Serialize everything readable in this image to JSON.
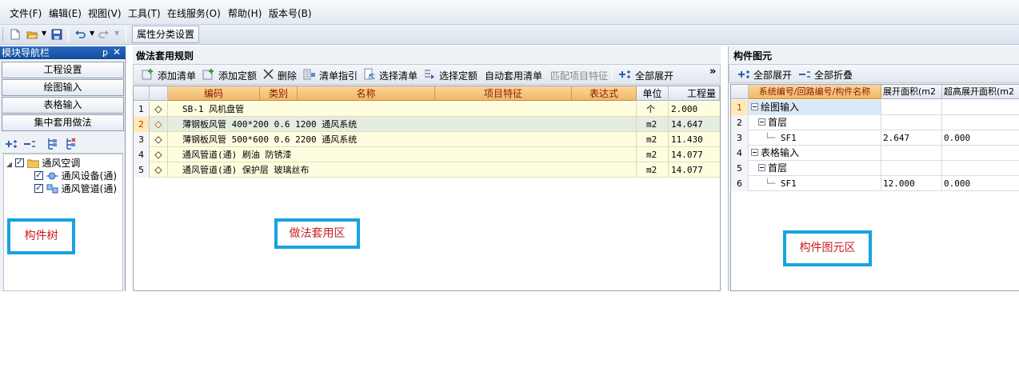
{
  "menubar": {
    "items": [
      "文件(F)",
      "编辑(E)",
      "视图(V)",
      "工具(T)",
      "在线服务(O)",
      "帮助(H)",
      "版本号(B)"
    ]
  },
  "toolbar": {
    "attr_button": "属性分类设置",
    "icons": [
      "new-file-icon",
      "open-folder-icon",
      "save-icon",
      "undo-icon",
      "redo-icon"
    ]
  },
  "left_panel": {
    "title": "模块导航栏",
    "pin": "ꝑ",
    "close": "✕",
    "nav_buttons": [
      "工程设置",
      "绘图输入",
      "表格输入",
      "集中套用做法"
    ],
    "tree": {
      "root": "通风空调",
      "children": [
        "通风设备(通)",
        "通风管道(通)"
      ]
    },
    "callout": "构件树"
  },
  "mid_panel": {
    "title": "做法套用规则",
    "toolbar": {
      "add_list": "添加清单",
      "add_quota": "添加定额",
      "delete": "删除",
      "list_guide": "清单指引",
      "select_list": "选择清单",
      "select_quota": "选择定额",
      "auto_apply": "自动套用清单",
      "match_feature": "匹配项目特征",
      "expand_all": "全部展开",
      "more": "»"
    },
    "columns": [
      "编码",
      "类别",
      "名称",
      "项目特征",
      "表达式",
      "单位",
      "工程量"
    ],
    "rows": [
      {
        "no": "1",
        "name": "SB-1 风机盘管",
        "unit": "个",
        "qty": "2.000"
      },
      {
        "no": "2",
        "name": "薄钢板风管 400*200 0.6 1200 通风系统",
        "unit": "m2",
        "qty": "14.647"
      },
      {
        "no": "3",
        "name": "薄钢板风管 500*600 0.6 2200 通风系统",
        "unit": "m2",
        "qty": "11.430"
      },
      {
        "no": "4",
        "name": "通风管道(通) 刷油 防锈漆",
        "unit": "m2",
        "qty": "14.077"
      },
      {
        "no": "5",
        "name": "通风管道(通) 保护层 玻璃丝布",
        "unit": "m2",
        "qty": "14.077"
      }
    ],
    "row_marker": "◇",
    "callout": "做法套用区"
  },
  "right_panel": {
    "title": "构件图元",
    "toolbar": {
      "expand_all": "全部展开",
      "collapse_all": "全部折叠"
    },
    "columns": [
      "系统编号/回路编号/构件名称",
      "展开面积(m2",
      "超高展开面积(m2"
    ],
    "rows": [
      {
        "no": "1",
        "name": "绘图输入",
        "area": "",
        "high_area": ""
      },
      {
        "no": "2",
        "name": "首层",
        "area": "",
        "high_area": ""
      },
      {
        "no": "3",
        "name": "SF1",
        "area": "2.647",
        "high_area": "0.000"
      },
      {
        "no": "4",
        "name": "表格输入",
        "area": "",
        "high_area": ""
      },
      {
        "no": "5",
        "name": "首层",
        "area": "",
        "high_area": ""
      },
      {
        "no": "6",
        "name": "SF1",
        "area": "12.000",
        "high_area": "0.000"
      }
    ],
    "callout": "构件图元区"
  },
  "colors": {
    "accent_blue": "#17a3e0",
    "callout_text": "#c81e1e",
    "header_orange": "#f0b867",
    "header_text": "#8b1a00"
  }
}
